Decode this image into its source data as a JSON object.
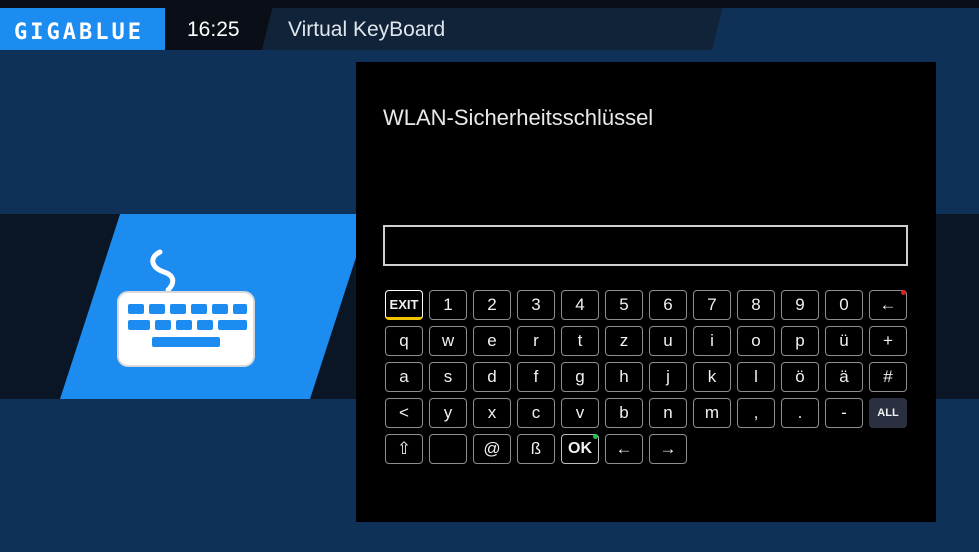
{
  "header": {
    "logo": "GIGABLUE",
    "time": "16:25",
    "title": "Virtual KeyBoard"
  },
  "dialog": {
    "prompt": "WLAN-Sicherheitsschlüssel",
    "input_value": ""
  },
  "keyboard": {
    "row1": [
      "EXIT",
      "1",
      "2",
      "3",
      "4",
      "5",
      "6",
      "7",
      "8",
      "9",
      "0",
      "←"
    ],
    "row2": [
      "q",
      "w",
      "e",
      "r",
      "t",
      "z",
      "u",
      "i",
      "o",
      "p",
      "ü",
      "+"
    ],
    "row3": [
      "a",
      "s",
      "d",
      "f",
      "g",
      "h",
      "j",
      "k",
      "l",
      "ö",
      "ä",
      "#"
    ],
    "row4": [
      "<",
      "y",
      "x",
      "c",
      "v",
      "b",
      "n",
      "m",
      ",",
      ".",
      "-",
      "ALL"
    ],
    "row5": [
      "⇧",
      "",
      "@",
      "ß",
      "OK",
      "←",
      "→"
    ]
  },
  "colors": {
    "accent": "#1c8cf0",
    "background": "#0f3157",
    "panel": "#000000",
    "exit_underline": "#f3c300"
  },
  "icons": [
    "keyboard-icon",
    "backspace-icon",
    "shift-icon",
    "arrow-left-icon",
    "arrow-right-icon"
  ]
}
